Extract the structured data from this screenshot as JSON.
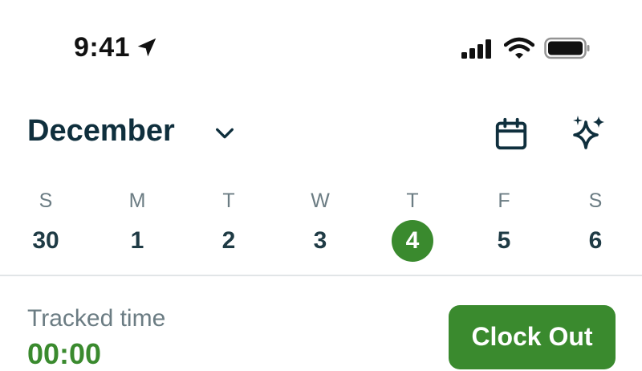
{
  "status_bar": {
    "time": "9:41",
    "icons": [
      "location-arrow-icon",
      "cellular-signal-icon",
      "wifi-icon",
      "battery-icon"
    ]
  },
  "header": {
    "month": "December",
    "icons": [
      "chevron-down-icon",
      "calendar-icon",
      "sparkles-icon"
    ]
  },
  "week": {
    "days": [
      {
        "dow": "S",
        "num": "30"
      },
      {
        "dow": "M",
        "num": "1"
      },
      {
        "dow": "T",
        "num": "2"
      },
      {
        "dow": "W",
        "num": "3"
      },
      {
        "dow": "T",
        "num": "4"
      },
      {
        "dow": "F",
        "num": "5"
      },
      {
        "dow": "S",
        "num": "6"
      }
    ],
    "selected_day": "4"
  },
  "tracker": {
    "label": "Tracked time",
    "value": "00:00",
    "clock_out_label": "Clock Out"
  },
  "colors": {
    "accent": "#3a8a2e",
    "heading": "#0f2f3d",
    "muted": "#6b7c83",
    "divider": "#e1e5e7"
  }
}
